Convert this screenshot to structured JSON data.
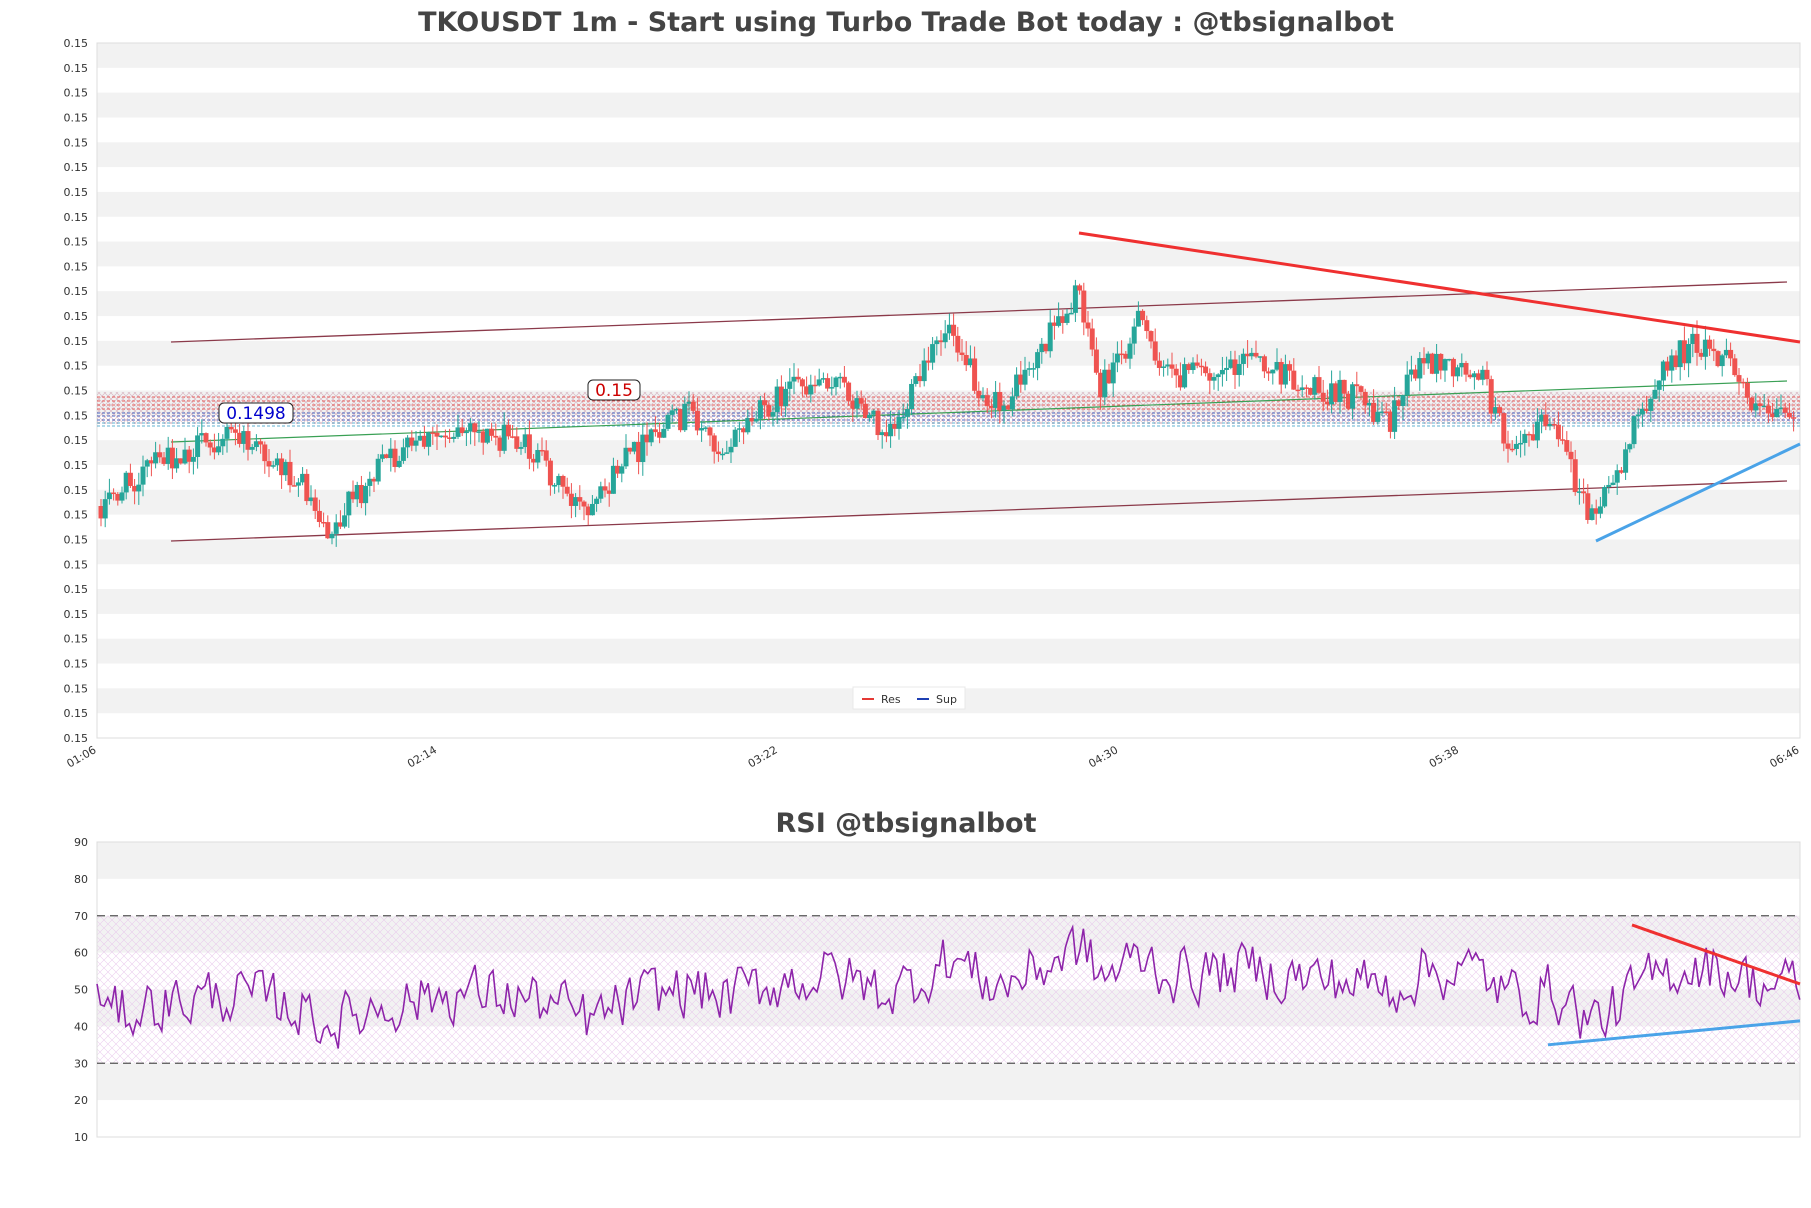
{
  "colors": {
    "up": "#26a69a",
    "down": "#ef5350",
    "resistance": "#e53935",
    "support": "#1e3fb3",
    "trend_down": "#ef3030",
    "trend_up": "#4aa3e8",
    "channel": "#8b3a4a",
    "sma": "#3aa055",
    "rsi_line": "#8e24aa",
    "band_fill": "#f2f2f2"
  },
  "chart_data": [
    {
      "type": "candlestick",
      "title": "TKOUSDT 1m - Start using Turbo Trade Bot today : @tbsignalbot",
      "y_tick_label": "0.15",
      "y_tick_count": 29,
      "x_ticks": [
        "01:06",
        "02:14",
        "03:22",
        "04:30",
        "05:38",
        "06:46"
      ],
      "price_tags": [
        {
          "text": "0.15",
          "color": "#cc0000"
        },
        {
          "text": "0.1498",
          "color": "#0000cc"
        }
      ],
      "legend": [
        {
          "name": "Res",
          "color": "#e53935"
        },
        {
          "name": "Sup",
          "color": "#1e3fb3"
        }
      ],
      "legend_position": "bottom-center",
      "grid": true
    },
    {
      "type": "line",
      "title": "RSI @tbsignalbot",
      "ylim": [
        10,
        90
      ],
      "y_ticks": [
        90,
        80,
        70,
        60,
        50,
        40,
        30,
        20,
        10
      ],
      "reference_lines": [
        70,
        30
      ],
      "grid": true
    }
  ]
}
